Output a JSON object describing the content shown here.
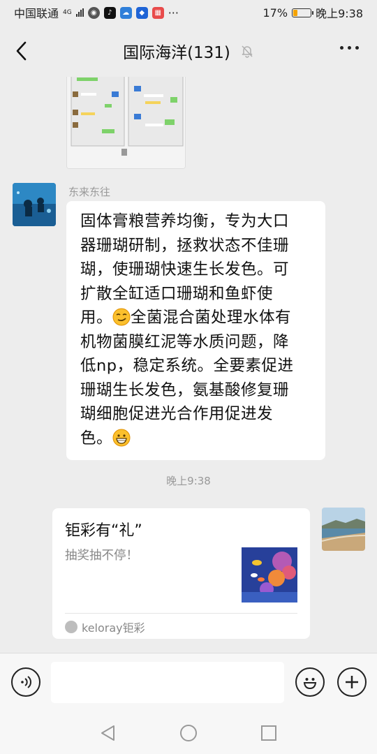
{
  "status_bar": {
    "carrier": "中国联通",
    "network": "4G",
    "battery": "17%",
    "time": "晚上9:38"
  },
  "header": {
    "title": "国际海洋(131)"
  },
  "messages": {
    "sender_name": "东来东往",
    "text_lines": [
      "固体膏粮营养均衡，专为大口",
      "器珊瑚研制，拯救状态不佳珊",
      "瑚，使珊瑚快速生长发色。可",
      "扩散全缸适口珊瑚和鱼虾使",
      "全菌混合菌处理水体有",
      "机物菌膜红泥等水质问题，降",
      "低np，稳定系统。全要素促进",
      "珊瑚生长发色，氨基酸修复珊",
      "瑚细胞促进光合作用促进发",
      "色。"
    ],
    "line5_prefix": "用。",
    "timestamp": "晚上9:38",
    "card": {
      "title": "钜彩有“礼”",
      "description": "抽奖抽不停！",
      "source": "keloray钜彩"
    }
  },
  "colors": {
    "background": "#ededed",
    "bubble": "#ffffff",
    "battery_level": "#f5a300"
  },
  "icons": [
    "back-arrow-icon",
    "mute-bell-icon",
    "more-icon",
    "voice-icon",
    "emoji-icon",
    "add-icon",
    "nav-back-icon",
    "nav-home-icon",
    "nav-recent-icon"
  ]
}
